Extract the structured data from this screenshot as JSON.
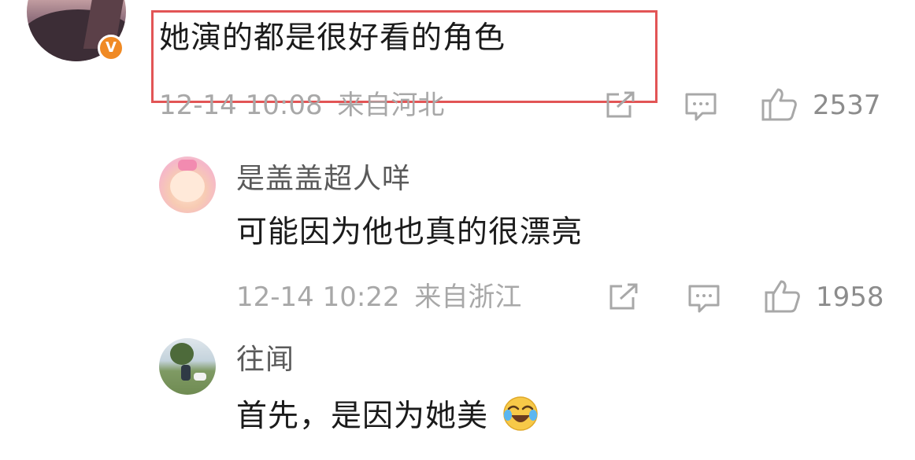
{
  "main_comment": {
    "text": "她演的都是很好看的角色",
    "timestamp": "12-14 10:08",
    "location": "来自河北",
    "like_count": "2537",
    "verified_badge": "V",
    "highlight_color": "#e25556"
  },
  "replies": [
    {
      "username": "是盖盖超人咩",
      "text": "可能因为他也真的很漂亮",
      "timestamp": "12-14 10:22",
      "location": "来自浙江",
      "like_count": "1958"
    },
    {
      "username": "往闻",
      "text": "首先，是因为她美",
      "emoji": "laughing-crying-emoji"
    }
  ],
  "icons": {
    "share": "share-icon",
    "comment": "comment-icon",
    "like": "thumbs-up-icon"
  },
  "colors": {
    "meta_text": "#a8a8a8",
    "badge": "#f08a24"
  }
}
